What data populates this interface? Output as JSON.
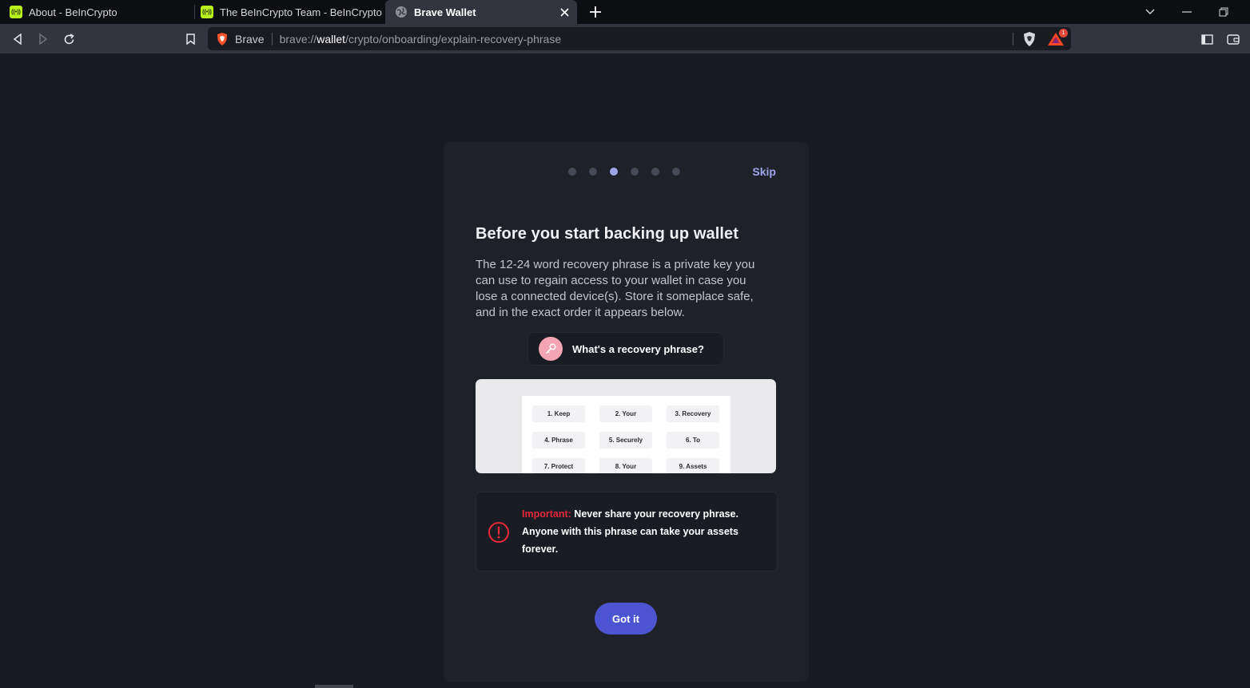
{
  "tabs": [
    {
      "title": "About - BeInCrypto",
      "favicon": "beincrypto-icon"
    },
    {
      "title": "The BeInCrypto Team - BeInCrypto",
      "favicon": "beincrypto-icon"
    },
    {
      "title": "Brave Wallet",
      "favicon": "globe-icon"
    }
  ],
  "omnibox": {
    "shield_label": "Brave",
    "url_prefix": "brave://",
    "url_host": "wallet",
    "url_path": "/crypto/onboarding/explain-recovery-phrase",
    "rewards_badge": "1"
  },
  "onboarding": {
    "steps_total": 6,
    "step_current": 3,
    "skip_label": "Skip",
    "title": "Before you start backing up wallet",
    "description": "The 12-24 word recovery phrase is a private key you can use to regain access to your wallet in case you lose a connected device(s). Store it someplace safe, and in the exact order it appears below.",
    "explain_label": "What's a recovery phrase?",
    "phrase_words": [
      "1. Keep",
      "2. Your",
      "3. Recovery",
      "4. Phrase",
      "5. Securely",
      "6. To",
      "7. Protect",
      "8. Your",
      "9. Assets"
    ],
    "warning_strong": "Important:",
    "warning_text": " Never share your recovery phrase. Anyone with this phrase can take your assets forever.",
    "got_it_label": "Got it"
  },
  "colors": {
    "accent": "#4c54d2",
    "skip": "#a0a5eb",
    "warning": "#e5283a"
  }
}
